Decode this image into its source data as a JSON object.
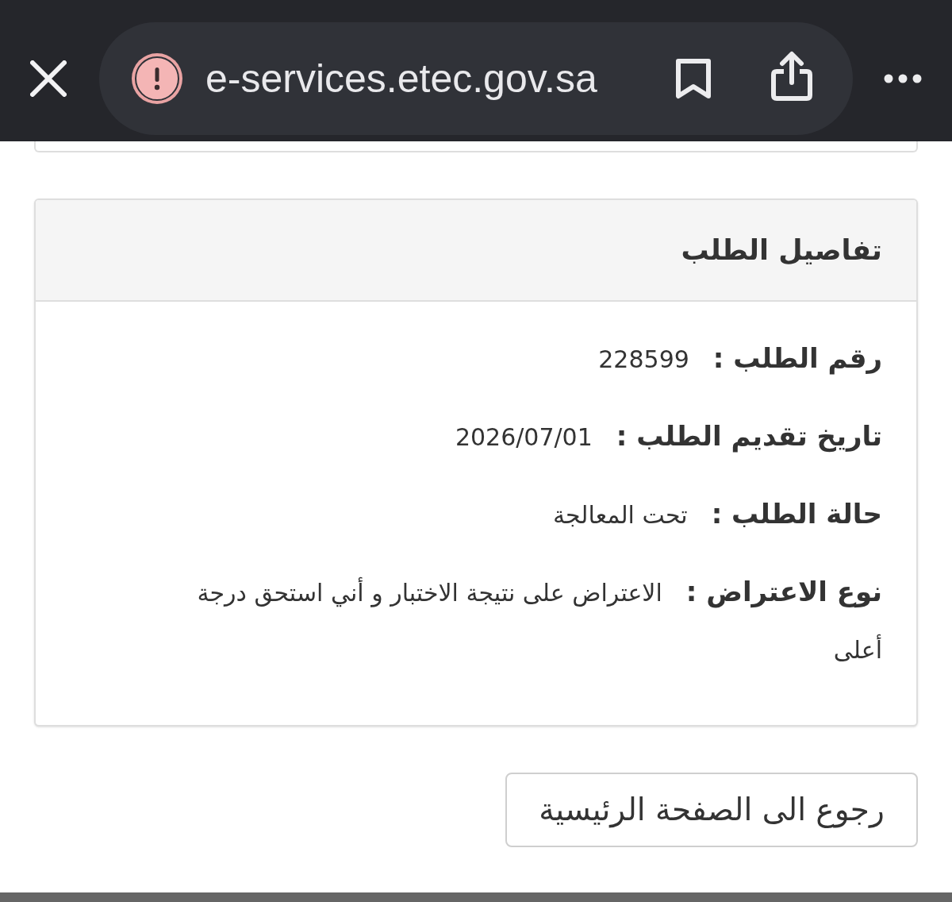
{
  "browser_bar": {
    "url": "e-services.etec.gov.sa"
  },
  "card": {
    "title": "تفاصيل الطلب",
    "fields": [
      {
        "label": "رقم الطلب :",
        "value": "228599"
      },
      {
        "label": "تاريخ تقديم الطلب :",
        "value": "2026/07/01"
      },
      {
        "label": "حالة الطلب :",
        "value": "تحت المعالجة"
      },
      {
        "label": "نوع الاعتراض :",
        "value": "الاعتراض على نتيجة الاختبار و أني استحق درجة أعلى"
      }
    ]
  },
  "buttons": [
    {
      "label": "رجوع الى الصفحة الرئيسية"
    }
  ]
}
